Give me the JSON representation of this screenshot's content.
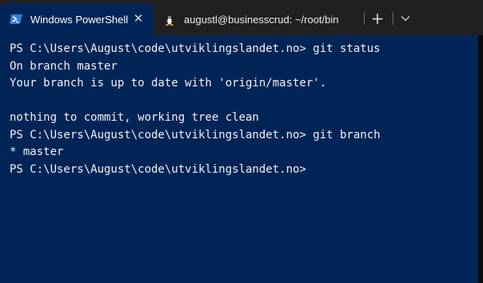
{
  "tabs": [
    {
      "label": "Windows PowerShell",
      "icon": "powershell-icon",
      "active": true,
      "close_glyph": "✕"
    },
    {
      "label": "augustl@businesscrud: ~/root/bin",
      "icon": "linux-penguin-icon",
      "active": false
    }
  ],
  "tabbar": {
    "new_tab_glyph": "+",
    "dropdown_icon": "chevron-down-icon"
  },
  "terminal": {
    "lines": [
      {
        "text": "PS C:\\Users\\August\\code\\utviklingslandet.no> git status"
      },
      {
        "text": "On branch master"
      },
      {
        "text": "Your branch is up to date with 'origin/master'."
      },
      {
        "text": ""
      },
      {
        "text": "nothing to commit, working tree clean"
      },
      {
        "text": "PS C:\\Users\\August\\code\\utviklingslandet.no> git branch"
      },
      {
        "text": "* master",
        "prefix": "* ",
        "branch": "master"
      },
      {
        "text": "PS C:\\Users\\August\\code\\utviklingslandet.no>"
      }
    ]
  },
  "colors": {
    "tabbar_background": "#202020",
    "terminal_background": "#012456",
    "terminal_foreground": "#f1f1f1",
    "current_branch": "#16c60c",
    "powershell_icon": "#2d7fd8"
  }
}
